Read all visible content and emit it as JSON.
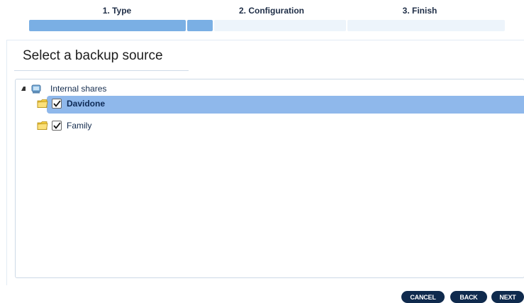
{
  "wizard": {
    "steps": [
      {
        "label": "1. Type",
        "state": "active"
      },
      {
        "label": "2. Configuration",
        "state": "pending"
      },
      {
        "label": "3. Finish",
        "state": "pending"
      }
    ],
    "progress_fraction": 0.39
  },
  "panel": {
    "title": "Select a backup source"
  },
  "tree": {
    "root": {
      "label": "Internal shares",
      "icon": "network-share-icon",
      "expanded": true
    },
    "items": [
      {
        "label": "Davidone",
        "icon": "folder-icon",
        "checked": true,
        "selected": true
      },
      {
        "label": "Family",
        "icon": "folder-icon",
        "checked": true,
        "selected": false
      }
    ]
  },
  "buttons": {
    "cancel": "CANCEL",
    "back": "BACK",
    "next": "NEXT"
  },
  "colors": {
    "progress_done": "#7aafe4",
    "progress_todo": "#edf4fb",
    "selection": "#8fb8eb",
    "button": "#0f2a4d"
  }
}
